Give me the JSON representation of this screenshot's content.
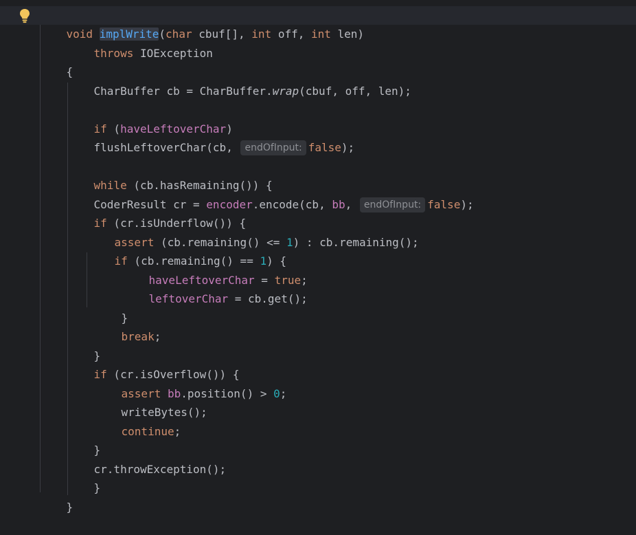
{
  "editor": {
    "signature": {
      "void": "void",
      "name": "implWrite",
      "open": "(",
      "char": "char",
      "p1": " cbuf[], ",
      "int1": "int",
      "p2": " off, ",
      "int2": "int",
      "p3": " len)"
    },
    "throws_kw": "throws",
    "throws_rest": " IOException",
    "brace_open": "{",
    "l4_a": "CharBuffer cb = CharBuffer.",
    "l4_wrap": "wrap",
    "l4_b": "(cbuf, off, len);",
    "l6_if": "if",
    "l6_a": " (",
    "l6_fld": "haveLeftoverChar",
    "l6_b": ")",
    "l7_a": "flushLeftoverChar(cb, ",
    "hint_label": "endOfInput:",
    "false_kw": "false",
    "l7_b": ");",
    "l9_while": "while",
    "l9_a": " (cb.hasRemaining()) {",
    "l10_a": "CoderResult cr = ",
    "l10_encoder": "encoder",
    "l10_b": ".encode(cb, ",
    "l10_bb": "bb",
    "l10_c": ", ",
    "l10_d": ");",
    "l11_if": "if",
    "l11_a": " (cr.isUnderflow()) {",
    "l12_assert": "assert",
    "l12_a": " (cb.remaining() <= ",
    "l12_num": "1",
    "l12_b": ") : cb.remaining();",
    "l13_if": "if",
    "l13_a": " (cb.remaining() == ",
    "l13_num": "1",
    "l13_b": ") {",
    "l14_fld": "haveLeftoverChar",
    "l14_a": " = ",
    "l14_true": "true",
    "l14_b": ";",
    "l15_fld": "leftoverChar",
    "l15_a": " = cb.get();",
    "brace_close": "}",
    "l17_break": "break",
    "l17_a": ";",
    "l19_if": "if",
    "l19_a": " (cr.isOverflow()) {",
    "l20_assert": "assert",
    "l20_bb": "bb",
    "l20_a": ".position() > ",
    "l20_num": "0",
    "l20_b": ";",
    "l21": "writeBytes();",
    "l22_continue": "continue",
    "l22_a": ";",
    "l24": "cr.throwException();",
    "colors": {
      "background": "#1e1f22",
      "keyword": "#cf8e6d",
      "function": "#56a8f5",
      "field": "#c77dbb",
      "number": "#2aacb8",
      "text": "#bcbec4",
      "bulb": "#f2c55c"
    }
  }
}
